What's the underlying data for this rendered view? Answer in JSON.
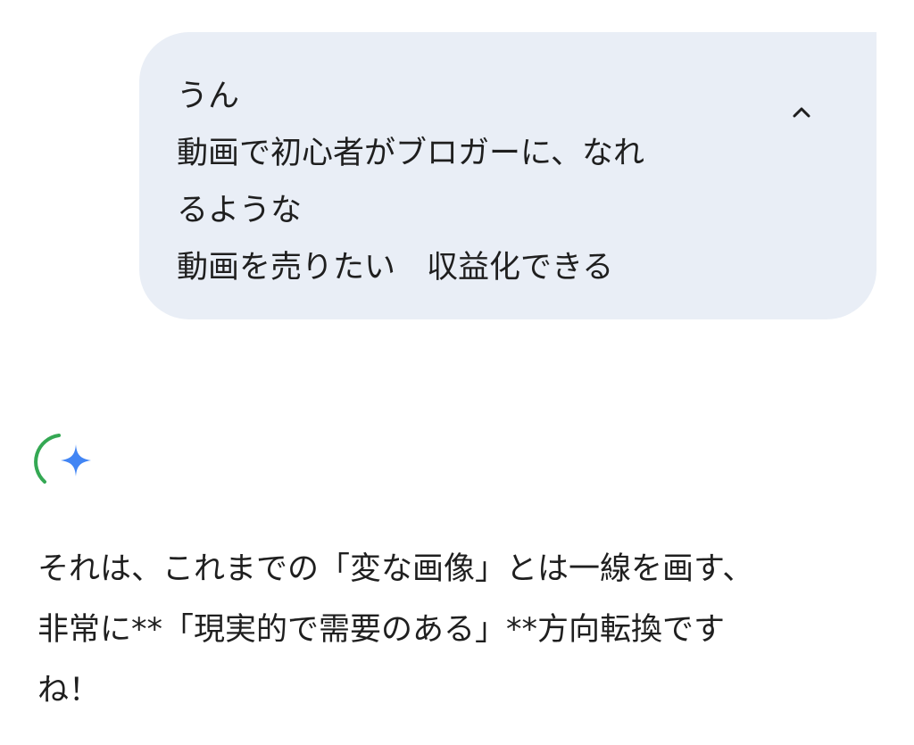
{
  "user_message": {
    "lines": [
      "うん",
      "動画で初心者がブロガーに、なれ",
      "るような",
      "動画を売りたい　収益化できる"
    ],
    "collapse_icon": "chevron-up-icon"
  },
  "assistant": {
    "avatar_icon": "gemini-sparkle-icon",
    "response_lines": [
      "それは、これまでの「変な画像」とは一線を画す、",
      "非常に**「現実的で需要のある」**方向転換です",
      "ね！"
    ]
  },
  "colors": {
    "bubble_background": "#e9eef6",
    "text": "#1f1f1f",
    "sparkle_blue": "#4285f4",
    "spinner_green": "#34a853"
  }
}
